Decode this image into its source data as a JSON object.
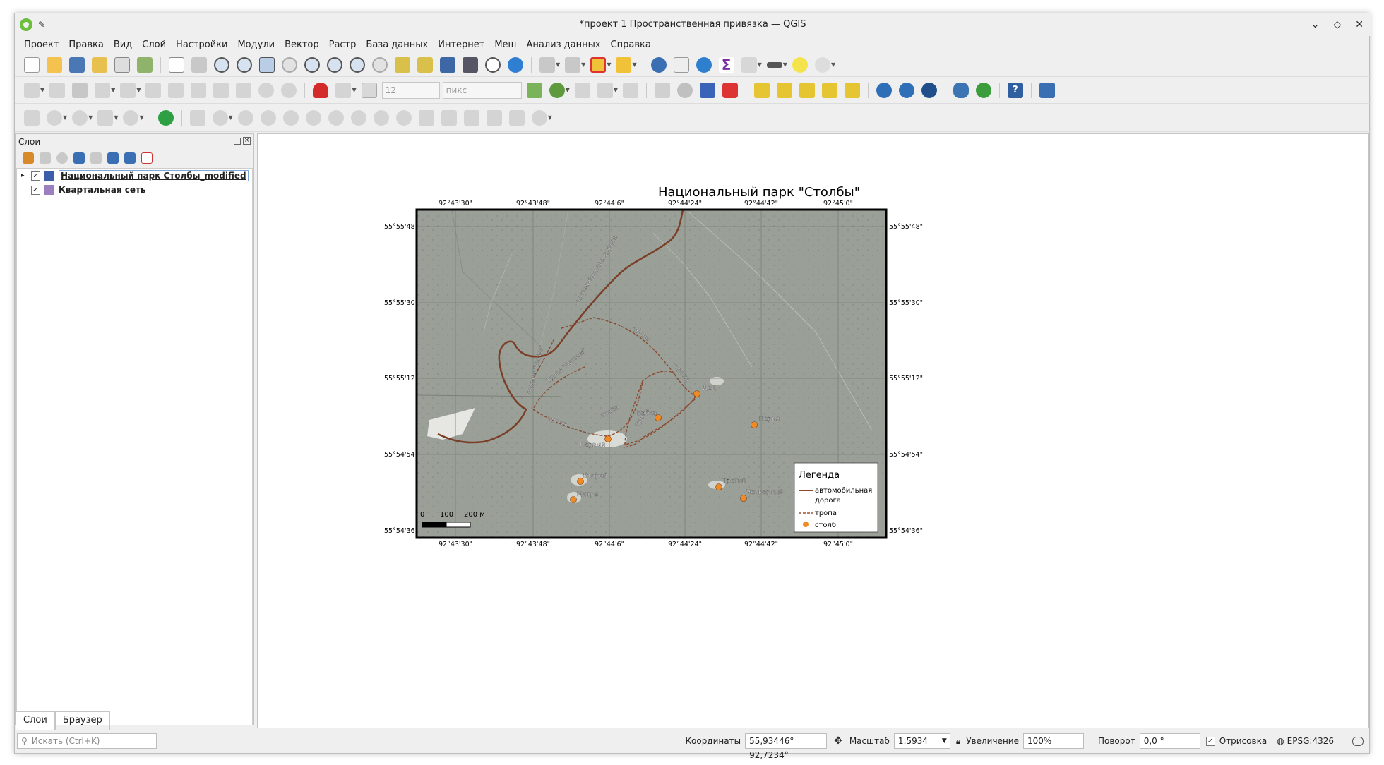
{
  "window": {
    "title": "*проект 1 Пространственная привязка — QGIS",
    "minimize": "⌄",
    "restore": "◇",
    "close": "✕"
  },
  "menu": [
    "Проект",
    "Правка",
    "Вид",
    "Слой",
    "Настройки",
    "Модули",
    "Вектор",
    "Растр",
    "База данных",
    "Интернет",
    "Меш",
    "Анализ данных",
    "Справка"
  ],
  "toolbar2": {
    "size_value": "12",
    "units_value": "пикс"
  },
  "layers_panel": {
    "title": "Слои",
    "layers": [
      {
        "name": "Национальный парк Столбы_modified",
        "checked": true,
        "color": "#3a5fa8"
      },
      {
        "name": "Квартальная сеть",
        "checked": true,
        "color": "#9b7fbf"
      }
    ],
    "tabs": [
      "Слои",
      "Браузер"
    ]
  },
  "map": {
    "title": "Национальный парк \"Столбы\"",
    "lon_ticks": [
      "92°43'30\"",
      "92°43'48\"",
      "92°44'6\"",
      "92°44'24\"",
      "92°44'42\"",
      "92°45'0\""
    ],
    "lat_ticks": [
      "55°55'48\"",
      "55°55'30\"",
      "55°55'12\"",
      "55°54'54\"",
      "55°54'36\""
    ],
    "road_label": "автомобильная дорога",
    "trail_labels": [
      "тропа",
      "тропа",
      "тропа",
      "тропа",
      "тропа"
    ],
    "named_trails": [
      "подъем \"Тыгыз\"",
      "Тропа \"Витьом\""
    ],
    "pillars": [
      "Дед",
      "Перья",
      "Бабка",
      "Первый",
      "Второй",
      "Митра",
      "Третий",
      "Четвертый"
    ],
    "scalebar": {
      "labels": [
        "0",
        "100",
        "200 м"
      ]
    },
    "legend": {
      "title": "Легенда",
      "items": [
        {
          "label": "автомобильная",
          "label2": "дорога",
          "color": "#8b4a2b"
        },
        {
          "label": "тропа",
          "color": "#a0522d"
        },
        {
          "label": "столб",
          "color": "#f08a24"
        }
      ]
    }
  },
  "status": {
    "search_placeholder": "Искать (Ctrl+K)",
    "coords_label": "Координаты",
    "coords_value": "55,93446° 92,7234°",
    "scale_label": "Масштаб",
    "scale_value": "1:5934",
    "zoom_label": "Увеличение",
    "zoom_value": "100%",
    "rotation_label": "Поворот",
    "rotation_value": "0,0 °",
    "render_label": "Отрисовка",
    "crs": "EPSG:4326"
  }
}
